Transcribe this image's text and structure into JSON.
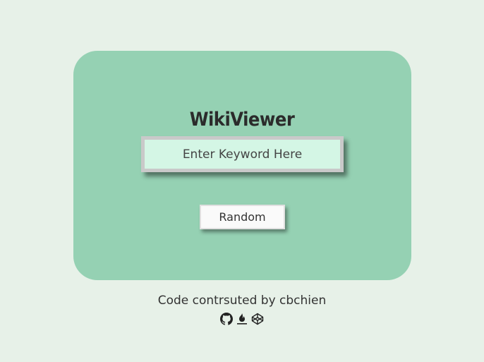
{
  "app": {
    "title": "WikiViewer"
  },
  "search": {
    "placeholder": "Enter Keyword Here",
    "value": ""
  },
  "actions": {
    "random_label": "Random"
  },
  "footer": {
    "credit": "Code contrsuted by cbchien",
    "icons": [
      "github-icon",
      "freecodecamp-icon",
      "codepen-icon"
    ]
  },
  "colors": {
    "background": "#e7f1e8",
    "card": "#95d1b3",
    "search_fill": "#d4f6e5",
    "text": "#2b2b2b"
  }
}
